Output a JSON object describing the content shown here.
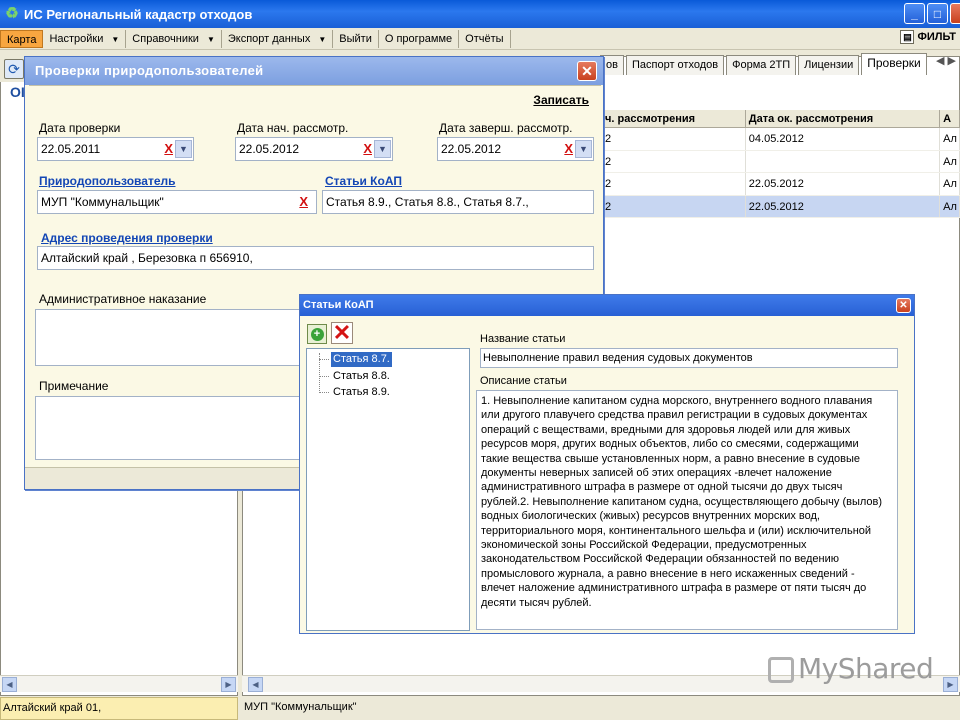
{
  "app": {
    "title": "ИС Региональный кадастр отходов",
    "menu": [
      {
        "label": "Карта",
        "active": true,
        "dropdown": false
      },
      {
        "label": "Настройки",
        "dropdown": true
      },
      {
        "label": "Справочники",
        "dropdown": true
      },
      {
        "label": "Экспорт данных",
        "dropdown": true
      },
      {
        "label": "Выйти",
        "dropdown": false
      },
      {
        "label": "О программе",
        "dropdown": false
      },
      {
        "label": "Отчёты",
        "dropdown": false
      }
    ],
    "filter_label": "ФИЛЬТ",
    "left_panel_title": "ОІ"
  },
  "tabs": [
    {
      "label": "ов"
    },
    {
      "label": "Паспорт отходов"
    },
    {
      "label": "Форма 2ТП"
    },
    {
      "label": "Лицензии"
    },
    {
      "label": "Проверки",
      "selected": true
    }
  ],
  "table": {
    "headers": [
      "ч. рассмотрения",
      "Дата ок. рассмотрения",
      "А"
    ],
    "rows": [
      {
        "c1": "2",
        "c2": "04.05.2012",
        "c3": "Ал",
        "selected": false
      },
      {
        "c1": "2",
        "c2": "",
        "c3": "Ал",
        "selected": false
      },
      {
        "c1": "2",
        "c2": "22.05.2012",
        "c3": "Ал",
        "selected": false
      },
      {
        "c1": "2",
        "c2": "22.05.2012",
        "c3": "Ал",
        "selected": true
      }
    ]
  },
  "status": {
    "left": "Алтайский край 01,",
    "right": "МУП \"Коммунальщик\""
  },
  "dialog_inspection": {
    "title": "Проверки природопользователей",
    "save_label": "Записать",
    "date_check_label": "Дата проверки",
    "date_check_value": "22.05.2011",
    "date_start_label": "Дата нач. рассмотр.",
    "date_start_value": "22.05.2012",
    "date_end_label": "Дата заверш. рассмотр.",
    "date_end_value": "22.05.2012",
    "user_label": "Природопользователь",
    "user_value": "МУП \"Коммунальщик\"",
    "articles_label": "Статьи КоАП",
    "articles_value": "Статья 8.9., Статья 8.8., Статья 8.7.,",
    "address_label": "Адрес проведения проверки",
    "address_value": "Алтайский край , Березовка п 656910,",
    "penalty_label": "Административное наказание",
    "note_label": "Примечание",
    "clear_glyph": "X"
  },
  "dialog_articles": {
    "title": "Статьи КоАП",
    "tree": [
      "Статья 8.7.",
      "Статья 8.8.",
      "Статья 8.9."
    ],
    "selected_index": 0,
    "name_label": "Название статьи",
    "name_value": "Невыполнение правил ведения судовых документов",
    "desc_label": "Описание статьи",
    "desc_lines": [
      "1. Невыполнение капитаном судна морского, внутреннего водного плавания",
      "или другого плавучего средства правил регистрации в судовых документах",
      "операций с веществами, вредными для здоровья людей или для живых",
      "ресурсов моря, других водных объектов, либо со смесями, содержащими",
      "такие вещества свыше установленных норм, а равно внесение в судовые",
      "документы неверных записей об этих операциях -влечет наложение",
      "административного штрафа в размере от одной тысячи до двух тысяч",
      "рублей.2. Невыполнение капитаном судна, осуществляющего добычу (вылов)",
      "водных биологических (живых) ресурсов внутренних морских вод,",
      "территориального моря, континентального шельфа и (или) исключительной",
      "экономической зоны Российской Федерации, предусмотренных",
      "законодательством Российской Федерации обязанностей по ведению",
      "промыслового журнала, а равно внесение в него искаженных сведений -",
      "влечет наложение административного штрафа в размере от пяти тысяч до",
      "десяти тысяч рублей."
    ]
  },
  "watermark": "MyShared"
}
